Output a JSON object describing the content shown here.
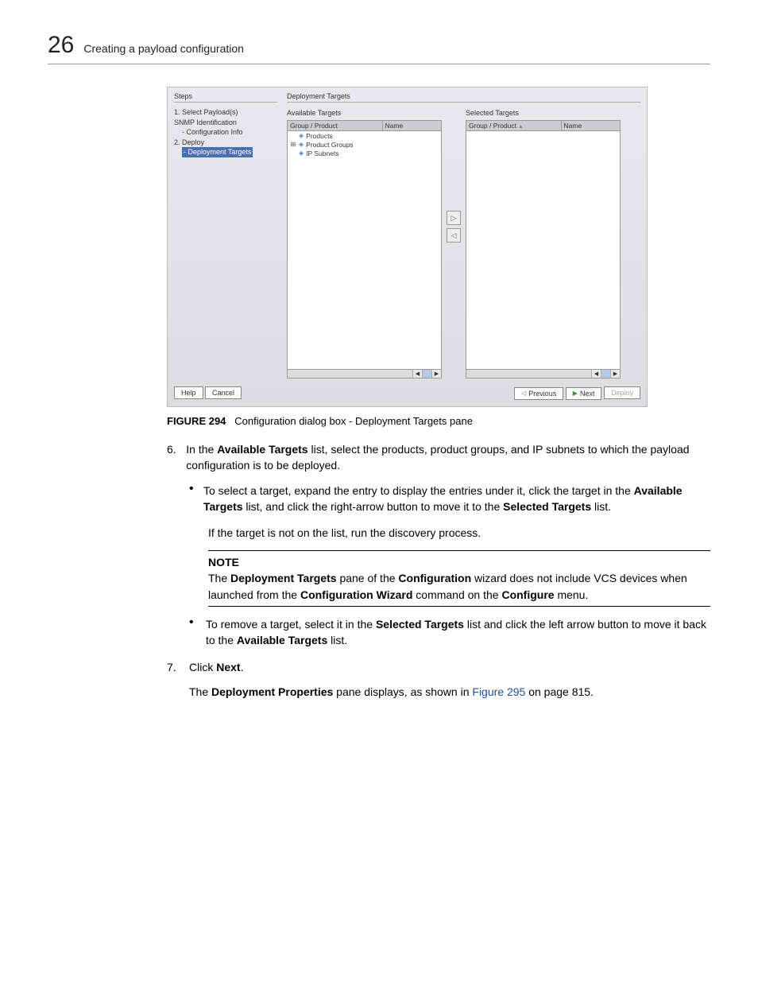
{
  "header": {
    "chapter_number": "26",
    "chapter_title": "Creating a payload configuration"
  },
  "dialog": {
    "steps_label": "Steps",
    "main_label": "Deployment Targets",
    "steps": {
      "s1": "1. Select Payload(s)",
      "s1a": "SNMP Identification",
      "s1b": "- Configuration Info",
      "s2": "2. Deploy",
      "s2a": "- Deployment Targets"
    },
    "available": {
      "title": "Available Targets",
      "col1": "Group / Product",
      "col2": "Name",
      "tree": {
        "r1": "Products",
        "r2": "Product Groups",
        "r3": "IP Subnets"
      }
    },
    "selected": {
      "title": "Selected Targets",
      "col1": "Group / Product",
      "col2": "Name"
    },
    "buttons": {
      "help": "Help",
      "cancel": "Cancel",
      "previous": "Previous",
      "next": "Next",
      "deploy": "Deploy"
    }
  },
  "caption": {
    "label": "FIGURE 294",
    "text": "Configuration dialog box - Deployment Targets pane"
  },
  "body": {
    "step6_num": "6.",
    "step6_a": "In the ",
    "step6_b": "Available Targets",
    "step6_c": " list, select the products, product groups, and IP subnets to which the payload configuration is to be deployed.",
    "b1_a": "To select a target, expand the entry to display the entries under it, click the target in the ",
    "b1_b": "Available Targets",
    "b1_c": " list, and click the right-arrow button to move it to the ",
    "b1_d": "Selected Targets",
    "b1_e": " list.",
    "b1_follow": "If the target is not on the list, run the discovery process.",
    "note_label": "NOTE",
    "note_a": "The ",
    "note_b": "Deployment Targets",
    "note_c": " pane of the ",
    "note_d": "Configuration",
    "note_e": " wizard does not include VCS devices when launched from the ",
    "note_f": "Configuration Wizard",
    "note_g": " command on the ",
    "note_h": "Configure",
    "note_i": " menu.",
    "b2_a": "To remove a target, select it in the ",
    "b2_b": "Selected Targets",
    "b2_c": " list and click the left arrow button to move it back to the ",
    "b2_d": "Available Targets",
    "b2_e": " list.",
    "step7_num": "7.",
    "step7_a": "Click ",
    "step7_b": "Next",
    "step7_c": ".",
    "step7_follow_a": "The ",
    "step7_follow_b": "Deployment Properties",
    "step7_follow_c": " pane displays, as shown in ",
    "step7_follow_link": "Figure 295",
    "step7_follow_d": " on page 815."
  }
}
